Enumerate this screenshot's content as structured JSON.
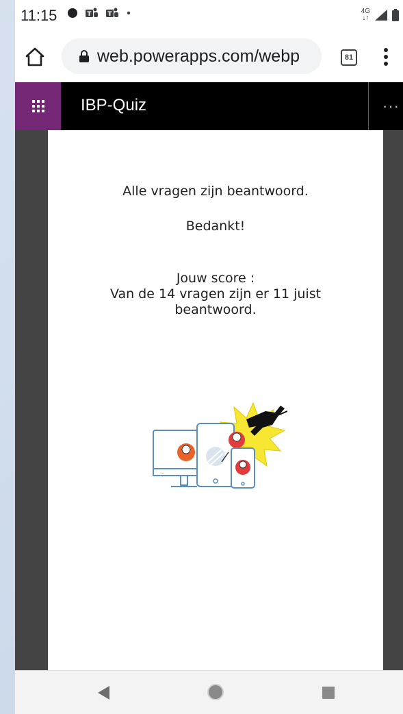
{
  "status_bar": {
    "time": "11:15",
    "network": "4G"
  },
  "browser": {
    "url": "web.powerapps.com/webp",
    "tab_count": "81"
  },
  "app": {
    "title": "IBP-Quiz",
    "more": "···",
    "brand_color": "#742774"
  },
  "screen": {
    "line_all_answered": "Alle vragen zijn beantwoord.",
    "line_thanks": "Bedankt!",
    "score_label": "Jouw score :",
    "score_line1": "Van de 14 vragen zijn er 11 juist",
    "score_line2": "beantwoord."
  },
  "nav": {
    "icons": [
      "back-icon",
      "home-icon",
      "recents-icon"
    ]
  }
}
